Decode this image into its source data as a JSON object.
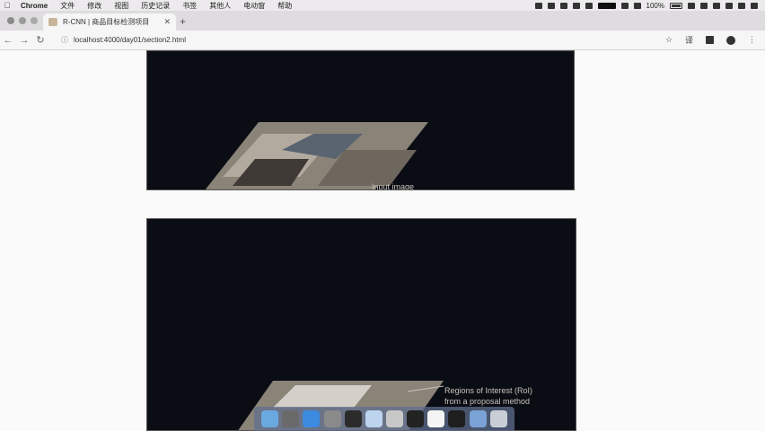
{
  "menubar": {
    "app": "Chrome",
    "items": [
      "文件",
      "修改",
      "视图",
      "历史记录",
      "书签",
      "其他人",
      "电动窗",
      "帮助"
    ],
    "battery": "100%"
  },
  "tab": {
    "title": "R-CNN | 商品目标检测项目"
  },
  "toolbar": {
    "url": "localhost:4000/day01/section2.html"
  },
  "slides": {
    "first_caption": "Input image",
    "second_caption_line1": "Regions of Interest (RoI)",
    "second_caption_line2": "from a proposal method"
  },
  "dock": {
    "apps": [
      "finder-icon",
      "launchpad-icon",
      "safari-icon",
      "settings-icon",
      "pycharm-icon",
      "preview-icon",
      "chrome-icon",
      "terminal-icon",
      "typora-icon",
      "openvpn-icon",
      "finder-window-icon",
      "trash-icon"
    ],
    "colors": [
      "#6aa8e0",
      "#6a6a6a",
      "#3d8be0",
      "#8a8a8a",
      "#2b2b2b",
      "#bcd4ee",
      "#c8c8c8",
      "#222222",
      "#f4f4f4",
      "#1e1e1e",
      "#7aa2d6",
      "#c9ced6"
    ]
  }
}
